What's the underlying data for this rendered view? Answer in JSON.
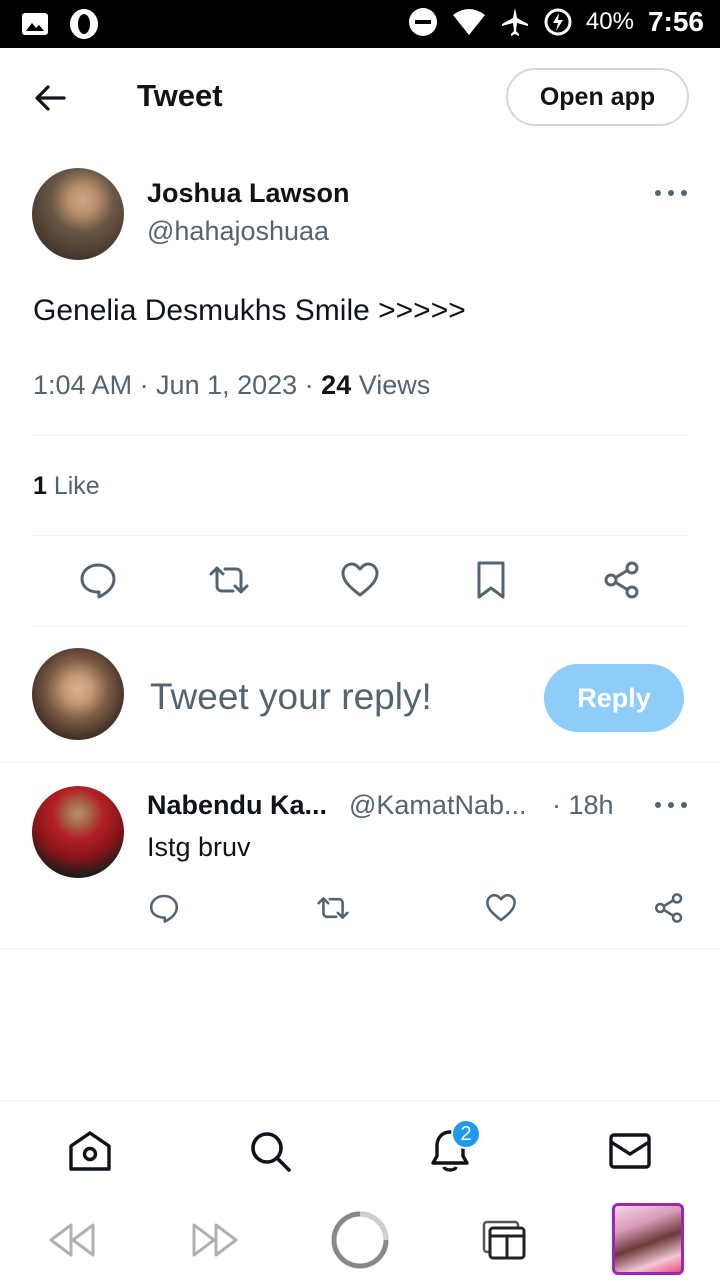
{
  "status_bar": {
    "battery": "40%",
    "time": "7:56"
  },
  "header": {
    "title": "Tweet",
    "open_app_label": "Open app"
  },
  "tweet": {
    "author_name": "Joshua Lawson",
    "author_handle": "@hahajoshuaa",
    "text": "Genelia Desmukhs Smile >>>>>",
    "time": "1:04 AM · Jun 1, 2023 · ",
    "views_count": "24",
    "views_label": " Views",
    "likes_count": "1",
    "likes_label": " Like"
  },
  "composer": {
    "placeholder": "Tweet your reply!",
    "reply_label": "Reply"
  },
  "reply": {
    "name": "Nabendu Ka...",
    "handle": "@KamatNab...",
    "time": "· 18h",
    "text": "Istg bruv"
  },
  "nav": {
    "notification_count": "2"
  },
  "colors": {
    "accent": "#1d9bf0",
    "reply_button": "#8ecdf8",
    "secondary_text": "#536471"
  }
}
